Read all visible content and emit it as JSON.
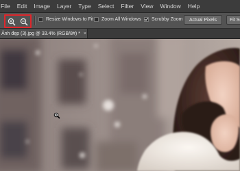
{
  "menubar": {
    "items": [
      "File",
      "Edit",
      "Image",
      "Layer",
      "Type",
      "Select",
      "Filter",
      "View",
      "Window",
      "Help"
    ]
  },
  "options_bar": {
    "tools": [
      {
        "icon": "zoom-in-icon"
      },
      {
        "icon": "zoom-out-icon"
      }
    ],
    "resize_windows_label": "Resize Windows to Fit",
    "zoom_all_windows_label": "Zoom All Windows",
    "scrubby_zoom_label": "Scrubby Zoom",
    "checkboxes": {
      "resize_windows": false,
      "zoom_all_windows": false,
      "scrubby_zoom": true
    },
    "actual_pixels_label": "Actual Pixels",
    "fit_screen_label": "Fit Screen",
    "highlight_color": "#e0262b"
  },
  "document_tab": {
    "title": "Ảnh đẹp (3).jpg @ 33.4% (RGB/8#) *",
    "close": "×"
  },
  "canvas": {
    "cursor_icon": "zoom-cursor-icon"
  }
}
